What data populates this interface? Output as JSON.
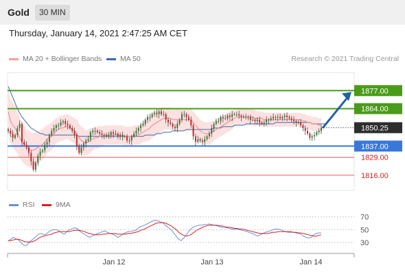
{
  "header": {
    "title": "Gold",
    "timeframe": "30 MIN"
  },
  "timestamp": "Thursday, January 14, 2021 2:47:25 AM CET",
  "legend": {
    "bb_label": "MA 20 + Bollinger Bands",
    "ma50_label": "MA 50",
    "credit": "Research © 2021 Trading Central"
  },
  "rsi_legend": {
    "rsi_label": "RSI",
    "ma_label": "9MA"
  },
  "colors": {
    "candle_up": "#2e7d32",
    "candle_down": "#c62828",
    "bollinger_fill": "#fbd7d7",
    "ma20": "#f08080",
    "ma50": "#3a6aa8",
    "resistance": "#4a9b1a",
    "pivot": "#3a78d8",
    "support": "#e06060",
    "rsi": "#6a8fd8",
    "rsi_ma": "#d42020",
    "arrow": "#2260a8"
  },
  "chart_data": [
    {
      "type": "candlestick",
      "ylim": [
        1806,
        1889
      ],
      "x_labels": [
        "Jan 12",
        "Jan 13",
        "Jan 14"
      ],
      "price_labels": [
        {
          "value": 1877.0,
          "text": "1877.00",
          "kind": "resistance"
        },
        {
          "value": 1864.0,
          "text": "1864.00",
          "kind": "resistance"
        },
        {
          "value": 1850.25,
          "text": "1850.25",
          "kind": "current"
        },
        {
          "value": 1837.0,
          "text": "1837.00",
          "kind": "pivot"
        },
        {
          "value": 1829.0,
          "text": "1829.00",
          "kind": "support"
        },
        {
          "value": 1816.0,
          "text": "1816.00",
          "kind": "support"
        }
      ],
      "close": [
        1848,
        1846,
        1843,
        1845,
        1850,
        1853,
        1840,
        1838,
        1836,
        1832,
        1826,
        1820,
        1825,
        1830,
        1833,
        1834,
        1838,
        1840,
        1845,
        1848,
        1850,
        1852,
        1852,
        1854,
        1855,
        1853,
        1852,
        1850,
        1848,
        1845,
        1837,
        1832,
        1836,
        1839,
        1841,
        1842,
        1847,
        1848,
        1848,
        1847,
        1846,
        1845,
        1845,
        1844,
        1845,
        1847,
        1846,
        1846,
        1844,
        1845,
        1844,
        1844,
        1841,
        1841,
        1844,
        1846,
        1848,
        1850,
        1852,
        1853,
        1856,
        1858,
        1858,
        1860,
        1861,
        1860,
        1862,
        1860,
        1860,
        1856,
        1854,
        1853,
        1851,
        1850,
        1853,
        1856,
        1860,
        1860,
        1858,
        1856,
        1852,
        1844,
        1840,
        1842,
        1841,
        1840,
        1842,
        1844,
        1846,
        1850,
        1853,
        1855,
        1855,
        1858,
        1857,
        1857,
        1859,
        1858,
        1860,
        1860,
        1860,
        1859,
        1858,
        1858,
        1858,
        1858,
        1856,
        1856,
        1855,
        1856,
        1854,
        1853,
        1854,
        1856,
        1856,
        1857,
        1858,
        1858,
        1858,
        1857,
        1858,
        1859,
        1858,
        1857,
        1856,
        1855,
        1854,
        1854,
        1852,
        1850,
        1848,
        1846,
        1843,
        1844,
        1845,
        1847,
        1848,
        1850
      ],
      "ma20": [
        1862,
        1855,
        1852,
        1850,
        1847,
        1843,
        1840,
        1838,
        1836,
        1835,
        1834,
        1834,
        1835,
        1836,
        1837,
        1838,
        1840,
        1842,
        1843,
        1844,
        1846,
        1848,
        1849,
        1850,
        1850,
        1851,
        1851,
        1850,
        1849,
        1848,
        1846,
        1843,
        1841,
        1840,
        1839,
        1840,
        1841,
        1842,
        1843,
        1843,
        1844,
        1844,
        1845,
        1845,
        1845,
        1845,
        1845,
        1845,
        1845,
        1845,
        1845,
        1844,
        1844,
        1844,
        1844,
        1845,
        1845,
        1845,
        1846,
        1847,
        1848,
        1849,
        1850,
        1852,
        1853,
        1854,
        1855,
        1856,
        1857,
        1857,
        1857,
        1857,
        1856,
        1856,
        1856,
        1856,
        1856,
        1856,
        1856,
        1856,
        1856,
        1854,
        1852,
        1850,
        1848,
        1847,
        1846,
        1846,
        1846,
        1847,
        1848,
        1849,
        1850,
        1851,
        1852,
        1853,
        1854,
        1855,
        1856,
        1857,
        1858,
        1858,
        1858,
        1858,
        1858,
        1858,
        1858,
        1858,
        1857,
        1857,
        1857,
        1857,
        1856,
        1856,
        1856,
        1856,
        1856,
        1856,
        1856,
        1856,
        1856,
        1856,
        1856,
        1856,
        1856,
        1856,
        1856,
        1856,
        1856,
        1855,
        1855,
        1854,
        1854,
        1853,
        1853,
        1853,
        1852,
        1852
      ],
      "bb_width": [
        15,
        16,
        16,
        16,
        15,
        15,
        14,
        14,
        13,
        13,
        13,
        12,
        12,
        12,
        11,
        11,
        11,
        10,
        10,
        10,
        10,
        9,
        9,
        9,
        9,
        9,
        9,
        9,
        9,
        9,
        10,
        10,
        10,
        10,
        9,
        9,
        9,
        8,
        8,
        8,
        8,
        7,
        7,
        7,
        7,
        7,
        7,
        7,
        7,
        7,
        7,
        7,
        7,
        7,
        7,
        7,
        7,
        7,
        7,
        7,
        8,
        8,
        9,
        9,
        9,
        9,
        9,
        9,
        8,
        8,
        8,
        8,
        8,
        8,
        8,
        8,
        8,
        8,
        8,
        8,
        8,
        8,
        8,
        8,
        8,
        8,
        8,
        8,
        8,
        8,
        7,
        7,
        7,
        7,
        7,
        7,
        7,
        7,
        7,
        6,
        6,
        6,
        6,
        6,
        6,
        6,
        6,
        6,
        6,
        5,
        5,
        5,
        5,
        5,
        5,
        5,
        5,
        5,
        5,
        5,
        5,
        5,
        5,
        5,
        5,
        5,
        5,
        5,
        5,
        5,
        5,
        5,
        5,
        5,
        5,
        5,
        5,
        5,
        5,
        5
      ],
      "ma50": [
        1880,
        1876,
        1872,
        1868,
        1864,
        1861,
        1858,
        1856,
        1854,
        1852,
        1850,
        1849,
        1848,
        1847,
        1846,
        1846,
        1845,
        1845,
        1845,
        1845,
        1845,
        1845,
        1845,
        1845,
        1845,
        1845,
        1845,
        1845,
        1845,
        1845,
        1845,
        1844,
        1844,
        1844,
        1844,
        1844,
        1844,
        1844,
        1844,
        1844,
        1844,
        1844,
        1844,
        1844,
        1844,
        1844,
        1844,
        1844,
        1844,
        1844,
        1844,
        1844,
        1844,
        1844,
        1844,
        1844,
        1844,
        1844,
        1844,
        1844,
        1845,
        1845,
        1845,
        1845,
        1845,
        1846,
        1846,
        1846,
        1847,
        1847,
        1847,
        1847,
        1848,
        1848,
        1848,
        1848,
        1848,
        1848,
        1849,
        1849,
        1849,
        1849,
        1849,
        1849,
        1849,
        1849,
        1849,
        1849,
        1849,
        1849,
        1850,
        1850,
        1850,
        1850,
        1851,
        1851,
        1851,
        1851,
        1851,
        1852,
        1852,
        1852,
        1852,
        1852,
        1853,
        1853,
        1853,
        1853,
        1853,
        1853,
        1853,
        1853,
        1853,
        1853,
        1853,
        1853,
        1853,
        1854,
        1854,
        1854,
        1854,
        1854,
        1854,
        1854,
        1854,
        1854,
        1854,
        1854,
        1854,
        1854,
        1854,
        1854,
        1854,
        1853,
        1853,
        1853,
        1853,
        1853,
        1853,
        1853
      ]
    },
    {
      "type": "line",
      "panel": "RSI",
      "ylim": [
        15,
        75
      ],
      "levels": [
        70,
        50,
        30
      ],
      "level_labels": [
        "70",
        "50",
        "30"
      ],
      "rsi": [
        32,
        35,
        38,
        36,
        34,
        30,
        26,
        25,
        29,
        33,
        36,
        40,
        43,
        44,
        42,
        43,
        47,
        49,
        50,
        50,
        48,
        45,
        43,
        47,
        50,
        51,
        53,
        52,
        48,
        45,
        43,
        40,
        38,
        40,
        42,
        44,
        45,
        47,
        48,
        46,
        44,
        43,
        41,
        38,
        40,
        43,
        45,
        47,
        47,
        48,
        49,
        52,
        55,
        56,
        58,
        60,
        62,
        64,
        65,
        64,
        62,
        60,
        56,
        53,
        50,
        45,
        40,
        35,
        33,
        37,
        42,
        48,
        52,
        55,
        56,
        57,
        57,
        58,
        58,
        59,
        58,
        57,
        56,
        55,
        54,
        53,
        53,
        52,
        51,
        51,
        51,
        50,
        49,
        48,
        47,
        45,
        44,
        42,
        40,
        42,
        44,
        46,
        47,
        48,
        50,
        51,
        51,
        50,
        48,
        47,
        46,
        46,
        46,
        45,
        44,
        43,
        40,
        38,
        37,
        38,
        42,
        44,
        45,
        45
      ],
      "rsi_ma": [
        33,
        33,
        34,
        35,
        35,
        34,
        32,
        31,
        31,
        31,
        32,
        34,
        37,
        39,
        40,
        41,
        42,
        43,
        45,
        46,
        47,
        47,
        47,
        47,
        47,
        48,
        49,
        49,
        49,
        48,
        47,
        45,
        44,
        43,
        42,
        42,
        42,
        43,
        43,
        44,
        44,
        44,
        44,
        43,
        43,
        43,
        43,
        44,
        44,
        45,
        46,
        47,
        49,
        50,
        52,
        54,
        56,
        58,
        60,
        61,
        61,
        61,
        60,
        58,
        56,
        53,
        50,
        46,
        43,
        41,
        40,
        41,
        43,
        46,
        49,
        51,
        53,
        55,
        56,
        57,
        57,
        57,
        57,
        56,
        56,
        55,
        54,
        54,
        53,
        52,
        52,
        51,
        51,
        50,
        49,
        48,
        47,
        46,
        45,
        44,
        44,
        44,
        44,
        45,
        46,
        46,
        47,
        47,
        47,
        47,
        47,
        47,
        46,
        46,
        45,
        45,
        44,
        43,
        42,
        41,
        40,
        40,
        41,
        42
      ]
    }
  ]
}
